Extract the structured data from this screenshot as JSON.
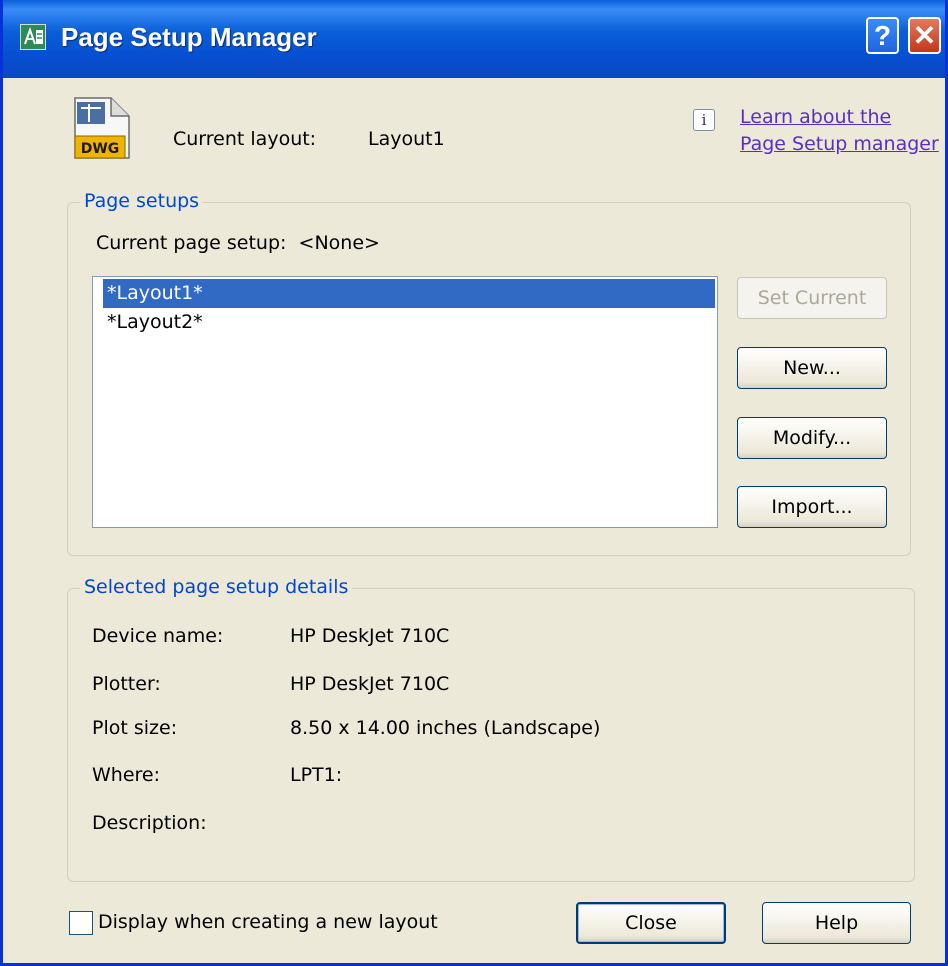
{
  "window": {
    "title": "Page Setup Manager",
    "help_glyph": "?",
    "close_glyph": "✕",
    "icons": {
      "app": "page-setup-icon",
      "help": "help-icon",
      "close": "close-icon"
    }
  },
  "header": {
    "current_layout_label": "Current layout:",
    "current_layout_value": "Layout1",
    "file_icon_text": "DWG",
    "info_glyph": "i",
    "learn_link_line1": "Learn about the",
    "learn_link_line2": "Page Setup manager"
  },
  "page_setups": {
    "group_title": "Page setups",
    "current_label": "Current page setup:",
    "current_value": "<None>",
    "items": [
      {
        "label": "*Layout1*",
        "selected": true
      },
      {
        "label": "*Layout2*",
        "selected": false
      }
    ],
    "buttons": {
      "set_current": "Set Current",
      "new": "New...",
      "modify": "Modify...",
      "import": "Import..."
    }
  },
  "details": {
    "group_title": "Selected page setup details",
    "rows": [
      {
        "label": "Device name:",
        "value": "HP DeskJet 710C"
      },
      {
        "label": "Plotter:",
        "value": "HP DeskJet 710C"
      },
      {
        "label": "Plot size:",
        "value": "8.50 x 14.00 inches (Landscape)"
      },
      {
        "label": "Where:",
        "value": "LPT1:"
      },
      {
        "label": "Description:",
        "value": ""
      }
    ]
  },
  "footer": {
    "checkbox_label": "Display when creating a new layout",
    "checkbox_checked": false,
    "close_label": "Close",
    "help_label": "Help"
  },
  "colors": {
    "title_bar": "#0a5fd8",
    "dialog_bg": "#ece9d8",
    "group_title": "#0046d5",
    "selection": "#316ac5",
    "link": "#5a2ec4"
  }
}
